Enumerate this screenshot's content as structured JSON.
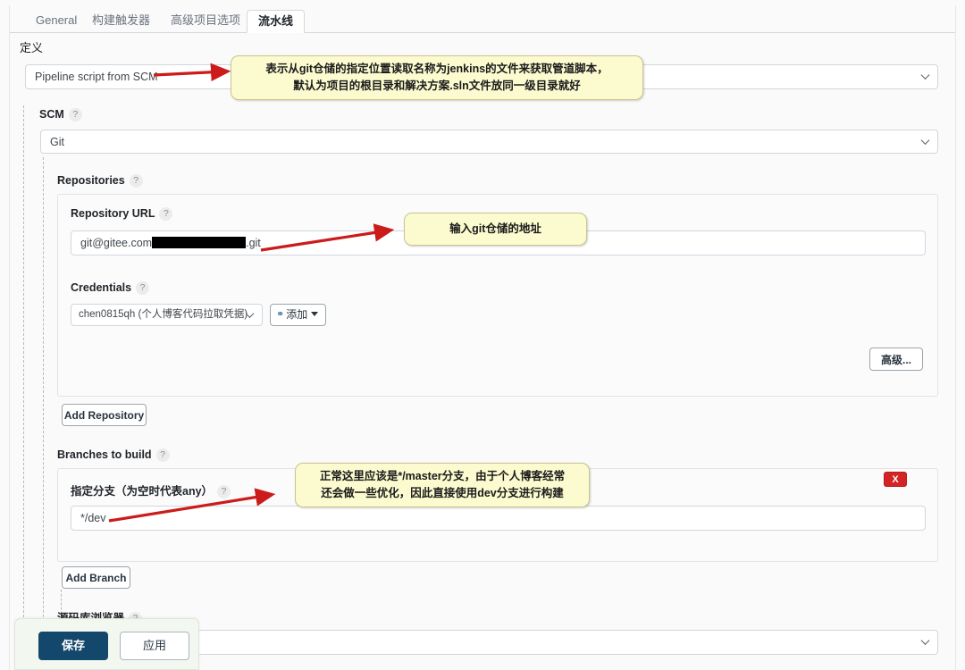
{
  "tabs": [
    {
      "label": "General",
      "active": false
    },
    {
      "label": "构建触发器",
      "active": false
    },
    {
      "label": "高级项目选项",
      "active": false
    },
    {
      "label": "流水线",
      "active": true
    }
  ],
  "definition": {
    "label": "定义",
    "value": "Pipeline script from SCM"
  },
  "scm": {
    "label": "SCM",
    "help": "?",
    "value": "Git"
  },
  "repositories": {
    "label": "Repositories",
    "help": "?",
    "url_label": "Repository URL",
    "url_help": "?",
    "url_prefix": "git@gitee.com",
    "url_suffix": ".git",
    "credentials_label": "Credentials",
    "credentials_help": "?",
    "credentials_value": "chen0815qh (个人博客代码拉取凭据)",
    "add_credential_label": "添加",
    "advanced_label": "高级...",
    "add_repository_label": "Add Repository"
  },
  "branches": {
    "label": "Branches to build",
    "help": "?",
    "specifier_label": "指定分支（为空时代表any）",
    "specifier_help": "?",
    "specifier_value": "*/dev",
    "delete_label": "X",
    "add_branch_label": "Add Branch"
  },
  "browser": {
    "label": "源码库浏览器",
    "help": "?",
    "value": ""
  },
  "annotations": [
    {
      "id": "definition-note",
      "line1": "表示从git仓储的指定位置读取名称为jenkins的文件来获取管道脚本，",
      "line2": "默认为项目的根目录和解决方案.sln文件放同一级目录就好"
    },
    {
      "id": "repo-url-note",
      "line1": "输入git仓储的地址",
      "line2": ""
    },
    {
      "id": "branch-note",
      "line1": "正常这里应该是*/master分支，由于个人博客经常",
      "line2": "还会做一些优化，因此直接使用dev分支进行构建"
    }
  ],
  "save_bar": {
    "save_label": "保存",
    "apply_label": "应用"
  },
  "colors": {
    "accent": "#13476b",
    "danger": "#d32323",
    "callout_bg": "#fcfbd0",
    "arrow": "#cc1b1b"
  }
}
